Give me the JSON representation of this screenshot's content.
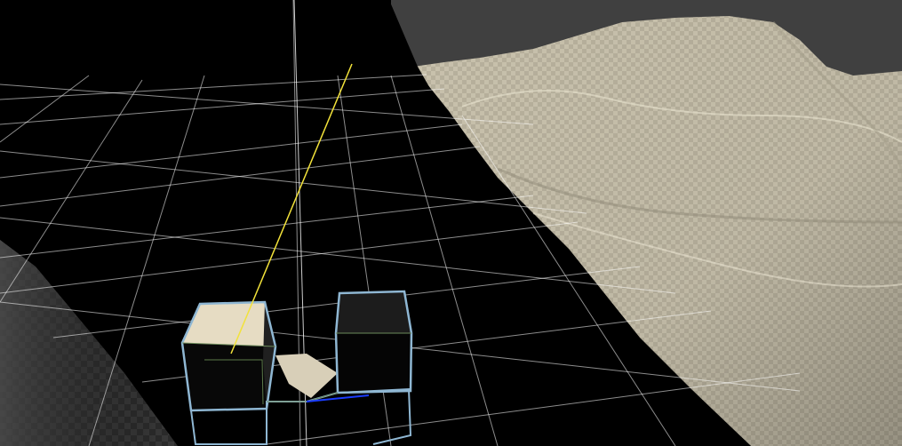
{
  "viewport": {
    "label": "",
    "background_color": "#000000",
    "sky_color": "#3f3f3f",
    "grid_color": "#ffffff",
    "terrain_color": "#c9c2ad",
    "terrain_checker_color": "#9a9484",
    "selection_outline_color": "#8fb7d3",
    "cube_face_light_color": "#e6dcc3",
    "cube_face_dark_color": "#141414",
    "ray_color": "#f2e23a",
    "axis_line_color": "#1a3cff"
  },
  "objects": [
    {
      "name": "terrain",
      "kind": "terrain-mesh"
    },
    {
      "name": "ground-grid",
      "kind": "grid"
    },
    {
      "name": "cube-left",
      "kind": "box",
      "selected": true
    },
    {
      "name": "cube-right",
      "kind": "box",
      "selected": true
    },
    {
      "name": "ray",
      "kind": "line"
    }
  ]
}
